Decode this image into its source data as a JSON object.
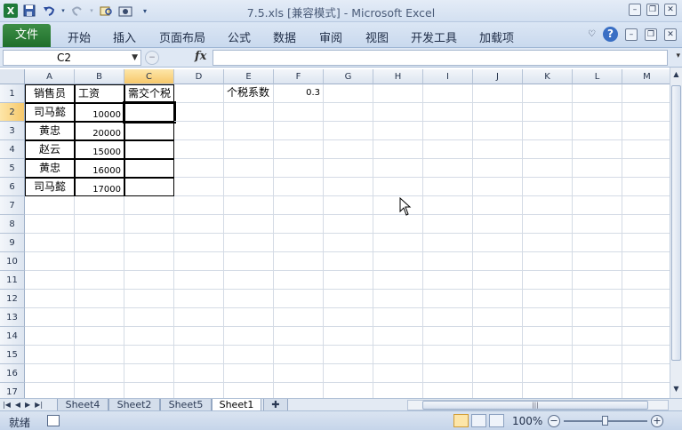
{
  "window": {
    "title": "7.5.xls  [兼容模式] - Microsoft Excel",
    "minimize": "–",
    "restore": "❐",
    "close": "✕"
  },
  "quick_access": {
    "logo": "X",
    "icons": [
      "save-icon",
      "undo-icon",
      "redo-icon",
      "print-preview-icon",
      "camera-icon",
      "customize-icon"
    ]
  },
  "ribbon": {
    "file_tab": "文件",
    "tabs": [
      "开始",
      "插入",
      "页面布局",
      "公式",
      "数据",
      "审阅",
      "视图",
      "开发工具",
      "加载项"
    ],
    "help": "?"
  },
  "formula_bar": {
    "name_box": "C2",
    "fx": "fx",
    "formula": ""
  },
  "grid": {
    "columns": [
      "A",
      "B",
      "C",
      "D",
      "E",
      "F",
      "G",
      "H",
      "I",
      "J",
      "K",
      "L",
      "M"
    ],
    "rows": [
      "1",
      "2",
      "3",
      "4",
      "5",
      "6",
      "7",
      "8",
      "9",
      "10",
      "11",
      "12",
      "13",
      "14",
      "15",
      "16",
      "17"
    ],
    "selected_column": "C",
    "selected_row": "2",
    "cells": {
      "A1": "销售员",
      "B1": "工资",
      "C1": "需交个税",
      "E1": "个税系数",
      "F1": "0.3",
      "A2": "司马懿",
      "B2": "10000",
      "A3": "黄忠",
      "B3": "20000",
      "A4": "赵云",
      "B4": "15000",
      "A5": "黄忠",
      "B5": "16000",
      "A6": "司马懿",
      "B6": "17000"
    }
  },
  "sheet_tabs": {
    "tabs": [
      "Sheet4",
      "Sheet2",
      "Sheet5",
      "Sheet1"
    ],
    "active": "Sheet1"
  },
  "status_bar": {
    "ready": "就绪",
    "zoom": "100%",
    "zoom_minus": "−",
    "zoom_plus": "+"
  }
}
